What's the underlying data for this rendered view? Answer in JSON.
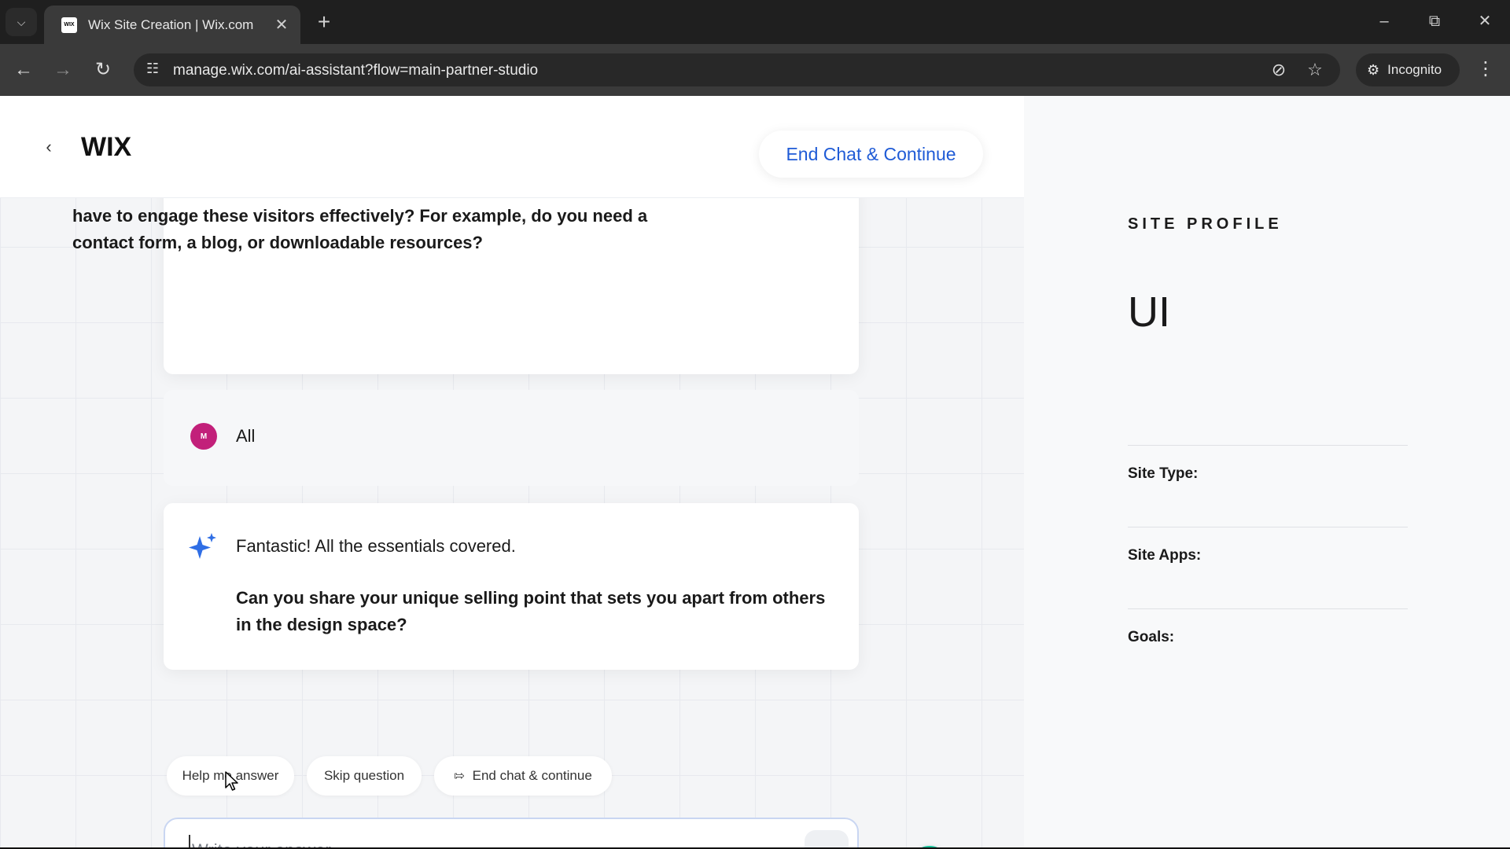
{
  "browser": {
    "tab_title": "Wix Site Creation | Wix.com",
    "favicon_text": "WIX",
    "url": "manage.wix.com/ai-assistant?flow=main-partner-studio",
    "incognito_label": "Incognito"
  },
  "header": {
    "logo": "WIX",
    "end_chat_button": "End Chat & Continue"
  },
  "chat": {
    "question_1": "have to engage these visitors effectively? For example, do you need a contact form, a blog, or downloadable resources?",
    "user_avatar_initial": "M",
    "user_answer": "All",
    "assistant_intro": "Fantastic! All the essentials covered.",
    "question_2": "Can you share your unique selling point that sets you apart from others in the design space?"
  },
  "quick_actions": {
    "help": "Help me answer",
    "skip": "Skip question",
    "end": "End chat & continue"
  },
  "input": {
    "placeholder": "Write your answer",
    "value": ""
  },
  "profile": {
    "section_label": "SITE PROFILE",
    "site_name": "UI",
    "fields": {
      "site_type": "Site Type:",
      "site_apps": "Site Apps:",
      "goals": "Goals:"
    }
  },
  "colors": {
    "accent": "#1f5bd6",
    "avatar": "#c2207a",
    "grammarly": "#15c39a"
  }
}
